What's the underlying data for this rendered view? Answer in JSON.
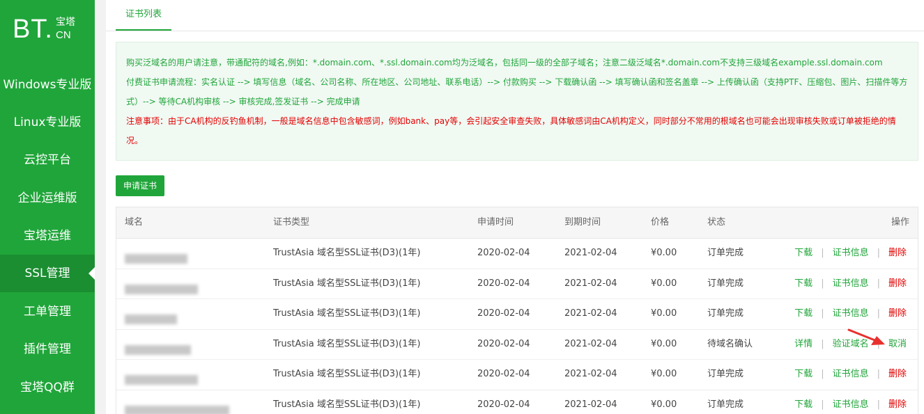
{
  "logo": {
    "bt": "BT.",
    "cn_top": "宝塔",
    "cn_bottom": "CN"
  },
  "sidebar": {
    "items": [
      {
        "label": "Windows专业版",
        "active": false
      },
      {
        "label": "Linux专业版",
        "active": false
      },
      {
        "label": "云控平台",
        "active": false
      },
      {
        "label": "企业运维版",
        "active": false
      },
      {
        "label": "宝塔运维",
        "active": false
      },
      {
        "label": "SSL管理",
        "active": true
      },
      {
        "label": "工单管理",
        "active": false
      },
      {
        "label": "插件管理",
        "active": false
      },
      {
        "label": "宝塔QQ群",
        "active": false
      }
    ]
  },
  "tabs": [
    {
      "label": "证书列表",
      "active": true
    }
  ],
  "notice": {
    "line1": "购买泛域名的用户请注意，带通配符的域名,例如：*.domain.com、*.ssl.domain.com均为泛域名，包括同一级的全部子域名；注意二级泛域名*.domain.com不支持三级域名example.ssl.domain.com",
    "line2": "付费证书申请流程：实名认证 --> 填写信息（域名、公司名称、所在地区、公司地址、联系电话）--> 付款购买 --> 下载确认函 --> 填写确认函和签名盖章 --> 上传确认函（支持PTF、压缩包、图片、扫描件等方式）--> 等待CA机构审核 --> 审核完成,签发证书 --> 完成申请",
    "warning": "注意事项：由于CA机构的反钓鱼机制，一般是域名信息中包含敏感词，例如bank、pay等，会引起安全审查失败，具体敏感词由CA机构定义，同时部分不常用的根域名也可能会出现审核失败或订单被拒绝的情况。"
  },
  "apply_button": "申请证书",
  "table": {
    "headers": {
      "domain": "域名",
      "type": "证书类型",
      "apply_time": "申请时间",
      "expire_time": "到期时间",
      "price": "价格",
      "status": "状态",
      "ops": "操作"
    },
    "rows": [
      {
        "type": "TrustAsia 域名型SSL证书(D3)(1年)",
        "apply_time": "2020-02-04",
        "expire_time": "2021-02-04",
        "price": "¥0.00",
        "status": "订单完成",
        "op1": "下载",
        "op2": "证书信息",
        "op3": "删除"
      },
      {
        "type": "TrustAsia 域名型SSL证书(D3)(1年)",
        "apply_time": "2020-02-04",
        "expire_time": "2021-02-04",
        "price": "¥0.00",
        "status": "订单完成",
        "op1": "下载",
        "op2": "证书信息",
        "op3": "删除"
      },
      {
        "type": "TrustAsia 域名型SSL证书(D3)(1年)",
        "apply_time": "2020-02-04",
        "expire_time": "2021-02-04",
        "price": "¥0.00",
        "status": "订单完成",
        "op1": "下载",
        "op2": "证书信息",
        "op3": "删除"
      },
      {
        "type": "TrustAsia 域名型SSL证书(D3)(1年)",
        "apply_time": "2020-02-04",
        "expire_time": "2021-02-04",
        "price": "¥0.00",
        "status": "待域名确认",
        "op1": "详情",
        "op2": "验证域名",
        "op3": "取消"
      },
      {
        "type": "TrustAsia 域名型SSL证书(D3)(1年)",
        "apply_time": "2020-02-04",
        "expire_time": "2021-02-04",
        "price": "¥0.00",
        "status": "订单完成",
        "op1": "下载",
        "op2": "证书信息",
        "op3": "删除"
      },
      {
        "type": "TrustAsia 域名型SSL证书(D3)(1年)",
        "apply_time": "2020-02-04",
        "expire_time": "2021-02-04",
        "price": "¥0.00",
        "status": "订单完成",
        "op1": "下载",
        "op2": "证书信息",
        "op3": "删除"
      }
    ]
  },
  "colors": {
    "brand": "#20a53a",
    "danger": "#e10000",
    "annotation_arrow": "#e8312e"
  }
}
